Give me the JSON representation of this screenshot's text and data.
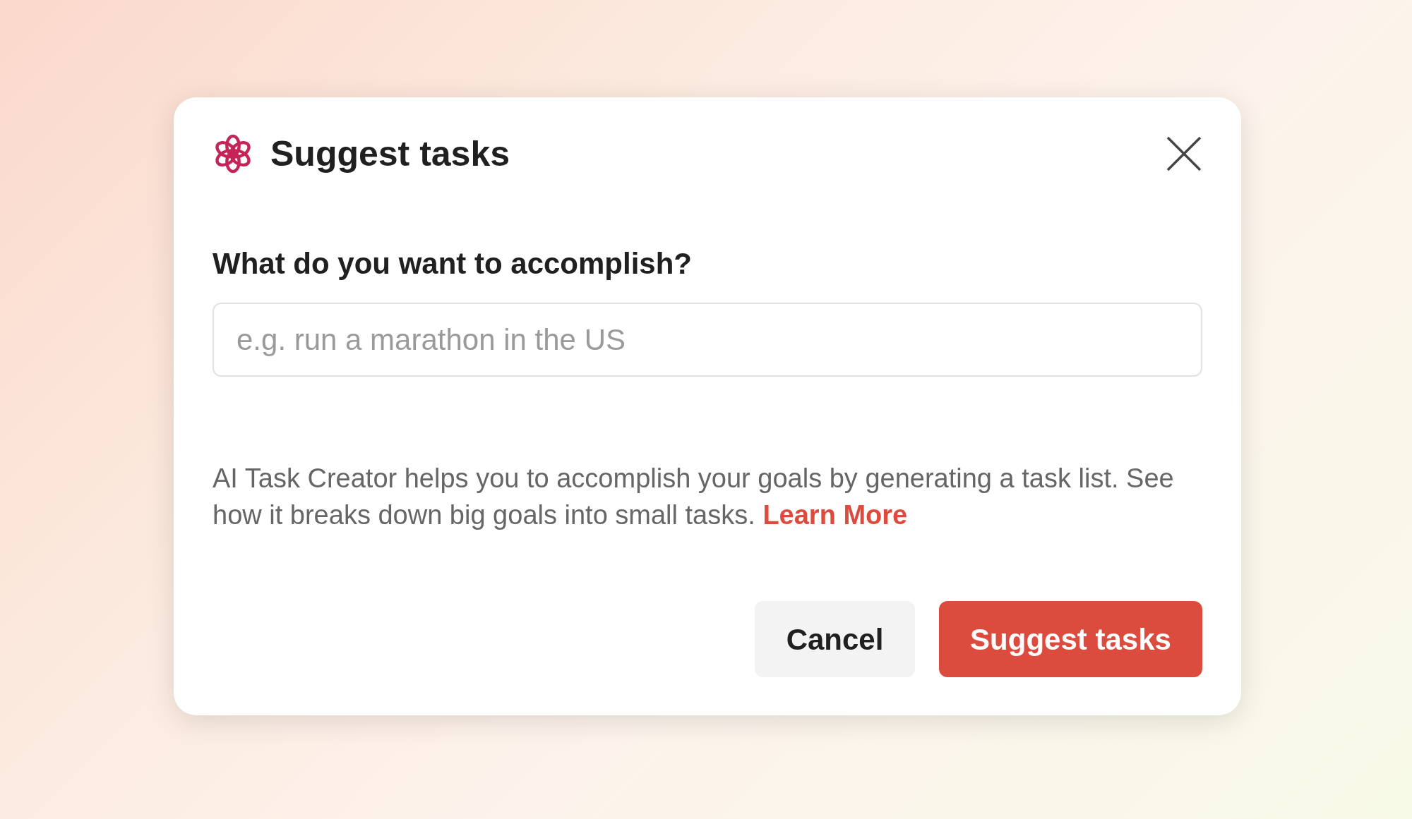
{
  "dialog": {
    "title": "Suggest tasks",
    "question": "What do you want to accomplish?",
    "input": {
      "placeholder": "e.g. run a marathon in the US"
    },
    "description": "AI Task Creator helps you to accomplish your goals by generating a task list. See how it breaks down big goals into small tasks.",
    "learn_more_link": "Learn More",
    "buttons": [
      {
        "label": "Cancel",
        "kind": "secondary"
      },
      {
        "label": "Suggest tasks",
        "kind": "primary"
      }
    ]
  }
}
